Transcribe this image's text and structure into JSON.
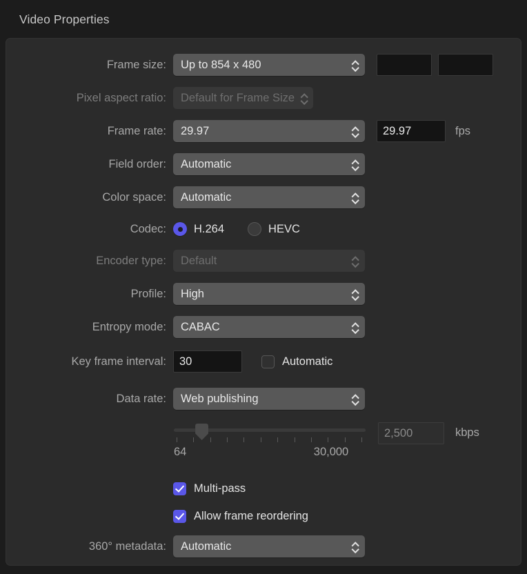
{
  "panel": {
    "title": "Video Properties"
  },
  "theme": {
    "accent": "#5a57e8",
    "page_bg": "#1c1c1c",
    "panel_bg": "#2b2b2b",
    "popup_bg": "#585858",
    "field_bg": "#141414",
    "label_color": "#a8a8a8",
    "disabled_color": "#6e6e6e"
  },
  "rows": {
    "frame_size": {
      "label": "Frame size:",
      "value": "Up to 854 x 480",
      "width_value": "",
      "height_value": ""
    },
    "pixel_aspect_ratio": {
      "label": "Pixel aspect ratio:",
      "value": "Default for Frame Size",
      "disabled": true
    },
    "frame_rate": {
      "label": "Frame rate:",
      "value": "29.97",
      "field_value": "29.97",
      "unit": "fps"
    },
    "field_order": {
      "label": "Field order:",
      "value": "Automatic"
    },
    "color_space": {
      "label": "Color space:",
      "value": "Automatic"
    },
    "codec": {
      "label": "Codec:",
      "options": [
        {
          "label": "H.264",
          "selected": true
        },
        {
          "label": "HEVC",
          "selected": false
        }
      ]
    },
    "encoder_type": {
      "label": "Encoder type:",
      "value": "Default",
      "disabled": true
    },
    "profile": {
      "label": "Profile:",
      "value": "High"
    },
    "entropy_mode": {
      "label": "Entropy mode:",
      "value": "CABAC"
    },
    "key_frame_interval": {
      "label": "Key frame interval:",
      "field_value": "30",
      "automatic_label": "Automatic",
      "automatic_checked": false
    },
    "data_rate": {
      "label": "Data rate:",
      "value": "Web publishing"
    },
    "data_rate_slider": {
      "min_label": "64",
      "max_label": "30,000",
      "kbps_value": "2,500",
      "kbps_unit": "kbps",
      "kbps_disabled": true,
      "tick_count": 12,
      "thumb_percent": 12
    },
    "multi_pass": {
      "label": "Multi-pass",
      "checked": true
    },
    "allow_frame_reordering": {
      "label": "Allow frame reordering",
      "checked": true
    },
    "metadata_360": {
      "label": "360° metadata:",
      "value": "Automatic"
    }
  }
}
